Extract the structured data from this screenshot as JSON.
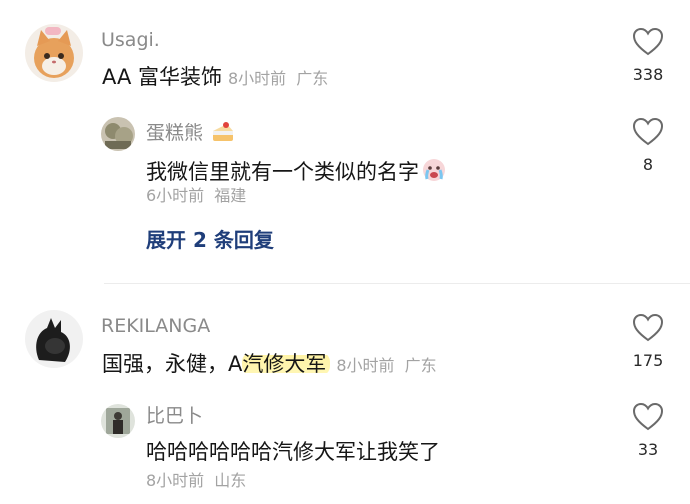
{
  "comments": [
    {
      "author": "Usagi.",
      "text": "AA 富华装饰",
      "time": "8小时前",
      "location": "广东",
      "likes": "338",
      "replies": [
        {
          "author": "蛋糕熊",
          "text": "我微信里就有一个类似的名字",
          "time": "6小时前",
          "location": "福建",
          "likes": "8"
        }
      ],
      "expand_label": "展开 2 条回复"
    },
    {
      "author": "REKILANGA",
      "text_before": "国强，永健，A",
      "text_highlight": "汽修大军",
      "time": "8小时前",
      "location": "广东",
      "likes": "175",
      "replies": [
        {
          "author": "比巴卜",
          "text": "哈哈哈哈哈哈汽修大军让我笑了",
          "time": "8小时前",
          "location": "山东",
          "likes": "33"
        }
      ]
    }
  ],
  "icons": {
    "like": "heart-outline-icon",
    "cake": "cake-emoji-icon",
    "crying": "crying-face-emoji-icon"
  },
  "colors": {
    "author": "#8a8a8a",
    "text": "#161616",
    "meta": "#a3a3a3",
    "expand": "#1f3e7a",
    "highlight": "#fff3a6"
  }
}
